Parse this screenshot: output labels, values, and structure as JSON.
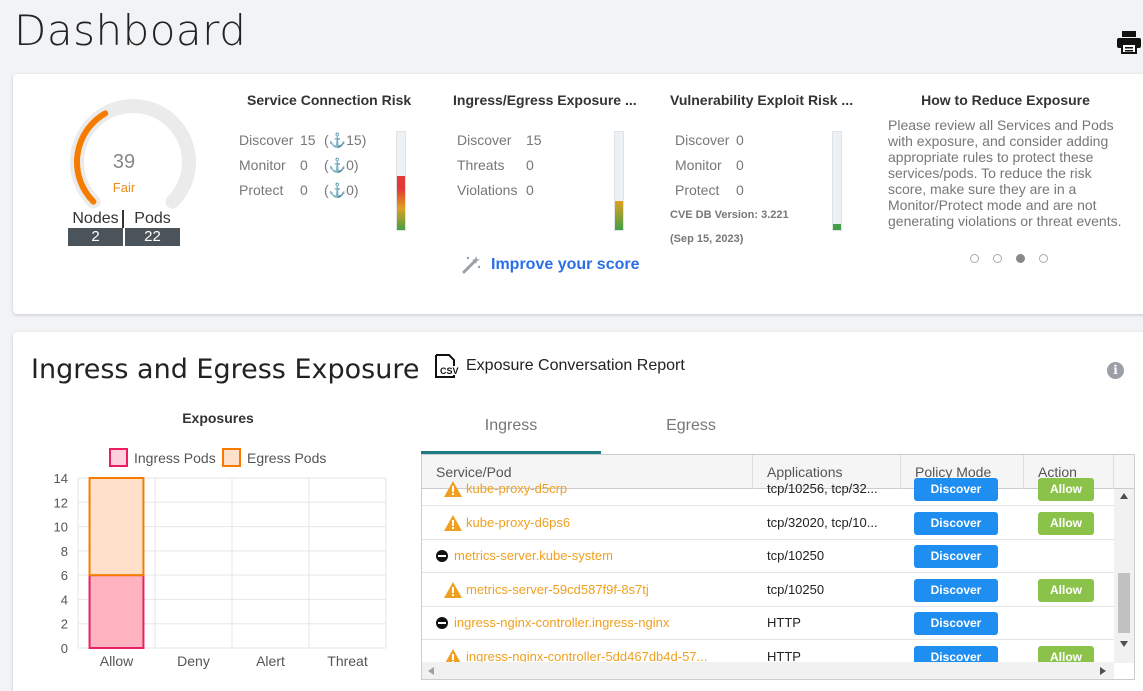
{
  "page_title": "Dashboard",
  "gauge": {
    "score": "39",
    "rating": "Fair",
    "score_fraction": 0.39,
    "color": "#f57c00"
  },
  "nodes": {
    "label": "Nodes",
    "value": "2"
  },
  "pods": {
    "label": "Pods",
    "value": "22"
  },
  "service_risk": {
    "title": "Service Connection Risk",
    "rows": [
      {
        "label": "Discover",
        "value": "15",
        "extra": "15"
      },
      {
        "label": "Monitor",
        "value": "0",
        "extra": "0"
      },
      {
        "label": "Protect",
        "value": "0",
        "extra": "0"
      }
    ],
    "bar_fraction": 0.55
  },
  "exposure_risk": {
    "title": "Ingress/Egress Exposure ...",
    "rows": [
      {
        "label": "Discover",
        "value": "15"
      },
      {
        "label": "Threats",
        "value": "0"
      },
      {
        "label": "Violations",
        "value": "0"
      }
    ],
    "bar_fraction": 0.3
  },
  "vuln_risk": {
    "title": "Vulnerability Exploit Risk ...",
    "rows": [
      {
        "label": "Discover",
        "value": "0"
      },
      {
        "label": "Monitor",
        "value": "0"
      },
      {
        "label": "Protect",
        "value": "0"
      }
    ],
    "cve_version": "CVE DB Version: 3.221",
    "cve_date": "(Sep 15, 2023)",
    "bar_fraction": 0.06
  },
  "improve_label": "Improve your score",
  "how_to": {
    "title": "How to Reduce Exposure",
    "text": "Please review all Services and Pods with exposure, and consider adding appropriate rules to protect these services/pods. To reduce the risk score, make sure they are in a Monitor/Protect mode and are not generating violations or threat events."
  },
  "section_title": "Ingress and Egress Exposure",
  "csv_label": "Exposure Conversation Report",
  "info_glyph": "i",
  "chart_data": {
    "type": "bar",
    "title": "Exposures",
    "categories": [
      "Allow",
      "Deny",
      "Alert",
      "Threat"
    ],
    "series": [
      {
        "name": "Ingress Pods",
        "values": [
          6,
          0,
          0,
          0
        ],
        "fill": "#ffb3c0",
        "stroke": "#e91e63"
      },
      {
        "name": "Egress Pods",
        "values": [
          8,
          0,
          0,
          0
        ],
        "fill": "#ffe0c8",
        "stroke": "#f57c00"
      }
    ],
    "stacked": true,
    "yticks": [
      "0",
      "2",
      "4",
      "6",
      "8",
      "10",
      "12",
      "14"
    ],
    "ylim": [
      0,
      14
    ]
  },
  "tabs": [
    {
      "label": "Ingress"
    },
    {
      "label": "Egress"
    }
  ],
  "table": {
    "headers": [
      "Service/Pod",
      "Applications",
      "Policy Mode",
      "Action"
    ],
    "rows": [
      {
        "name": "kube-proxy-d5crp",
        "icon": "warning",
        "apps": "tcp/10256, tcp/32...",
        "mode": "Discover",
        "action": "Allow"
      },
      {
        "name": "kube-proxy-d6ps6",
        "icon": "warning",
        "apps": "tcp/32020, tcp/10...",
        "mode": "Discover",
        "action": "Allow"
      },
      {
        "name": "metrics-server.kube-system",
        "icon": "block",
        "apps": "tcp/10250",
        "mode": "Discover",
        "action": ""
      },
      {
        "name": "metrics-server-59cd587f9f-8s7tj",
        "icon": "warning",
        "apps": "tcp/10250",
        "mode": "Discover",
        "action": "Allow"
      },
      {
        "name": "ingress-nginx-controller.ingress-nginx",
        "icon": "block",
        "apps": "HTTP",
        "mode": "Discover",
        "action": ""
      },
      {
        "name": "ingress-nginx-controller-5dd467db4d-57...",
        "icon": "warning",
        "apps": "HTTP",
        "mode": "Discover",
        "action": "Allow"
      }
    ]
  }
}
